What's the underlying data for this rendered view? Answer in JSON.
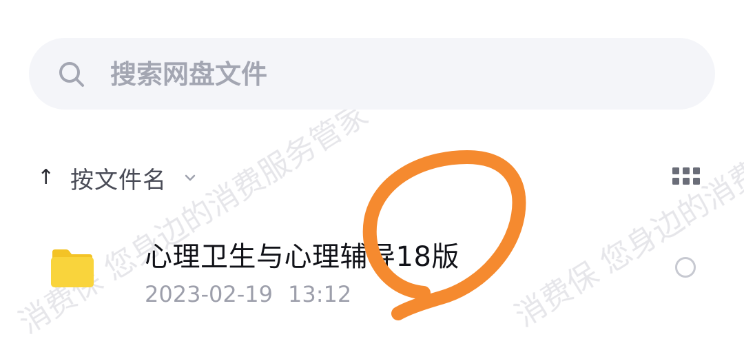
{
  "search": {
    "placeholder": "搜索网盘文件"
  },
  "sort": {
    "arrow": "↑",
    "label": "按文件名"
  },
  "files": [
    {
      "name": "心理卫生与心理辅导18版",
      "date": "2023-02-19",
      "time": "13:12"
    }
  ],
  "watermark": {
    "text": "消费保 您身边的消费服务管家"
  },
  "colors": {
    "folder": "#f9d43c",
    "annotation": "#f58a2f",
    "search_bg": "#f4f5f9"
  }
}
